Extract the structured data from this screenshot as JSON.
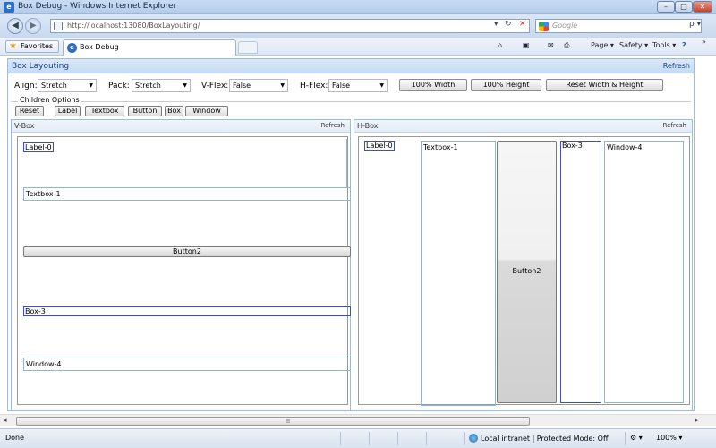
{
  "window": {
    "title": "Box Debug - Windows Internet Explorer",
    "min_glyph": "–",
    "max_glyph": "□",
    "close_glyph": "✕"
  },
  "address": {
    "url": "http://localhost:13080/BoxLayouting/",
    "search_placeholder": "Google",
    "search_go": "ρ ▾",
    "back_glyph": "◀",
    "fwd_glyph": "▶",
    "dropdown_glyph": "▾",
    "refresh_glyph": "↻",
    "stop_glyph": "✕"
  },
  "favorites": {
    "favorites_label": "Favorites",
    "tab_label": "Box Debug",
    "page_menu": "Page ▾",
    "safety_menu": "Safety ▾",
    "tools_menu": "Tools ▾",
    "help_glyph": "?",
    "home_glyph": "⌂",
    "feeds_glyph": "▣",
    "mail_glyph": "✉",
    "print_glyph": "⎙",
    "chevron": "»"
  },
  "main_panel": {
    "title": "Box Layouting",
    "refresh": "Refresh"
  },
  "toolbar": {
    "align_label": "Align:",
    "align_value": "Stretch",
    "pack_label": "Pack:",
    "pack_value": "Stretch",
    "vflex_label": "V-Flex:",
    "vflex_value": "False",
    "hflex_label": "H-Flex:",
    "hflex_value": "False",
    "width_btn": "100% Width",
    "height_btn": "100% Height",
    "reset_wh_btn": "Reset Width & Height",
    "select_arrow": "▼"
  },
  "children_options": {
    "legend": "Children Options",
    "buttons": [
      "Reset",
      "Label",
      "Textbox",
      "Button",
      "Box",
      "Window"
    ]
  },
  "vbox": {
    "title": "V-Box",
    "refresh": "Refresh",
    "label": "Label-0",
    "textbox": "Textbox-1",
    "button": "Button2",
    "box": "Box-3",
    "window": "Window-4"
  },
  "hbox": {
    "title": "H-Box",
    "refresh": "Refresh",
    "label": "Label-0",
    "textbox": "Textbox-1",
    "button": "Button2",
    "box": "Box-3",
    "window": "Window-4"
  },
  "scroll": {
    "left_glyph": "◂",
    "right_glyph": "▸",
    "grip_glyph": "≡"
  },
  "status": {
    "text": "Done",
    "zone": "Local intranet | Protected Mode: Off",
    "zoom": "100% ▾",
    "tool_glyph": "⚙ ▾"
  }
}
